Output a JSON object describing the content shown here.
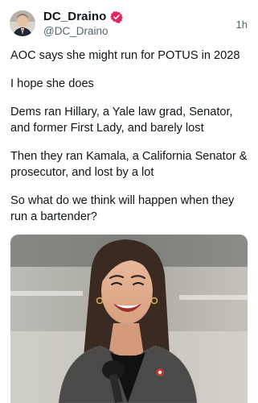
{
  "post": {
    "display_name": "DC_Draino",
    "handle": "@DC_Draino",
    "timestamp": "1h",
    "verified_icon": "verified-badge-icon",
    "verified_color": "#e0245e",
    "paragraphs": [
      "AOC says she might run for POTUS in 2028",
      "I hope she does",
      "Dems ran Hillary, a Yale law grad, Senator, and former First Lady, and barely lost",
      "Then they ran Kamala, a California Senator & prosecutor, and lost by a lot",
      "So what do we think will happen when they run a bartender?"
    ]
  }
}
